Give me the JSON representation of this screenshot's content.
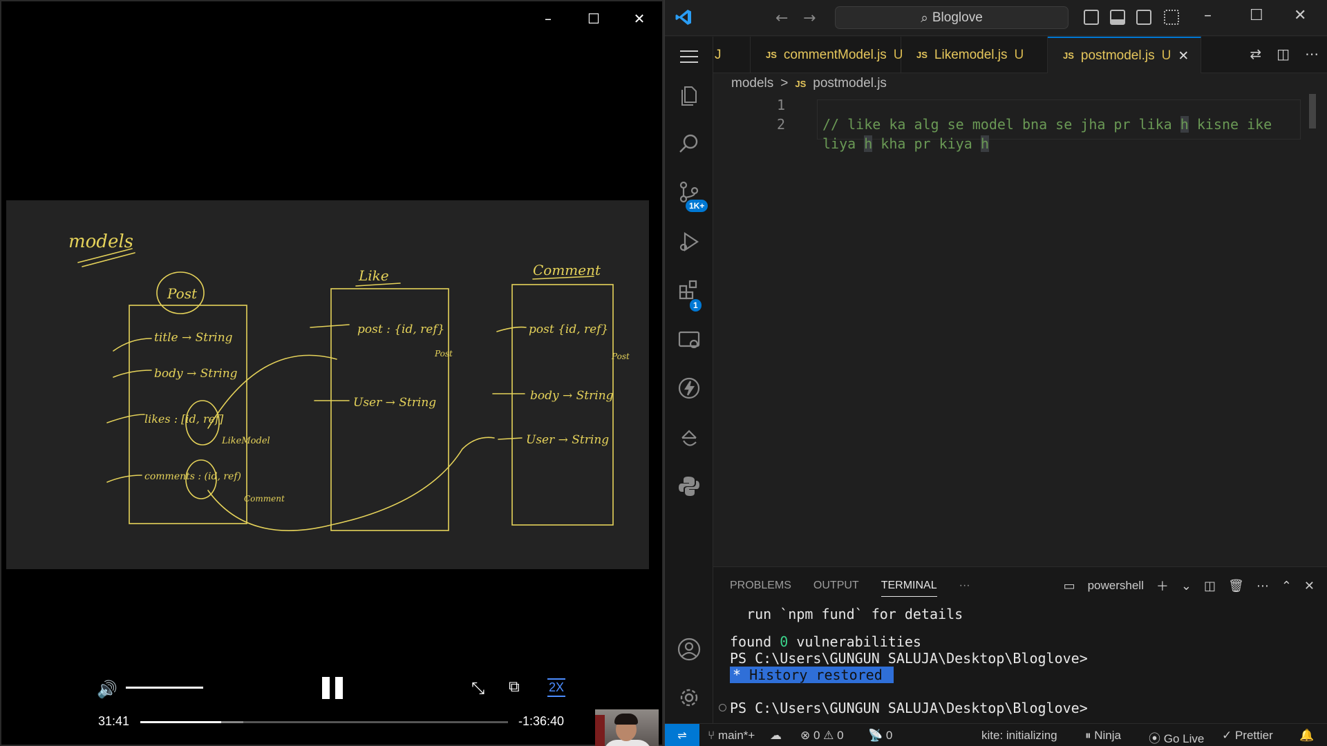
{
  "player": {
    "window_controls": {
      "minimize": "–",
      "maximize": "☐",
      "close": "✕"
    },
    "whiteboard": {
      "heading": "models",
      "boxes": [
        "Post",
        "Like",
        "Comment"
      ],
      "post_fields": [
        "title → String",
        "body → String",
        "likes → [id, ref] LikeModel",
        "comments → [id, ref] Comment"
      ],
      "like_fields": [
        "post: {id, ref} Post",
        "User → String"
      ],
      "comment_fields": [
        "post {id, ref} Post",
        "body → String",
        "User → String"
      ]
    },
    "controls": {
      "volume_icon": "🔊",
      "current_time": "31:41",
      "remaining_time": "-1:36:40",
      "speed": "2X",
      "progress": 0.22,
      "buffered": 0.28,
      "volume": 1.0
    }
  },
  "vscode": {
    "search": {
      "text": "Bloglove"
    },
    "tabs": [
      {
        "lang": "JS",
        "name": "J",
        "status": ""
      },
      {
        "lang": "JS",
        "name": "commentModel.js",
        "status": "U"
      },
      {
        "lang": "JS",
        "name": "Likemodel.js",
        "status": "U"
      },
      {
        "lang": "JS",
        "name": "postmodel.js",
        "status": "U",
        "active": true
      }
    ],
    "breadcrumb": {
      "folder": "models",
      "sep": ">",
      "lang": "JS",
      "file": "postmodel.js"
    },
    "editor": {
      "line_numbers": [
        "1",
        "2"
      ],
      "line2_a": "// like ka alg se model bna se jha pr lika ",
      "line2_h1": "h",
      "line2_b": " kisne ike",
      "line2c_a": "liya ",
      "line2c_h2": "h",
      "line2c_b": " kha pr kiya ",
      "line2c_h3": "h"
    },
    "activity": {
      "source_control_badge": "1K+",
      "extensions_badge": "1"
    },
    "panel": {
      "tabs": [
        "PROBLEMS",
        "OUTPUT",
        "TERMINAL"
      ],
      "more": "···",
      "shell": "powershell",
      "terminal": {
        "line1": "  run `npm fund` for details",
        "found": "found ",
        "vuln_count": "0",
        "vuln_text": " vulnerabilities",
        "prompt1": "PS C:\\Users\\GUNGUN SALUJA\\Desktop\\Bloglove>",
        "restored_star": "*",
        "restored_text": " History restored ",
        "prompt2": "PS C:\\Users\\GUNGUN SALUJA\\Desktop\\Bloglove>"
      }
    },
    "statusbar": {
      "branch": "main*+",
      "errors": "0",
      "warnings": "0",
      "ports": "0",
      "kite": "kite: initializing",
      "ninja": "Ninja",
      "golive": "Go Live",
      "prettier": "Prettier"
    },
    "accent_color": "#0078d4"
  }
}
